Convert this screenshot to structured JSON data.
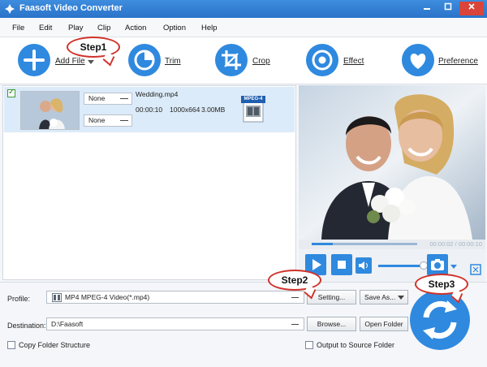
{
  "window": {
    "title": "Faasoft Video Converter"
  },
  "menu": [
    "File",
    "Edit",
    "Play",
    "Clip",
    "Action",
    "Option",
    "Help"
  ],
  "toolbar": {
    "add_file": "Add File",
    "trim": "Trim",
    "crop": "Crop",
    "effect": "Effect",
    "preference": "Preference"
  },
  "callouts": {
    "step1": "Step1",
    "step2": "Step2",
    "step3": "Step3"
  },
  "file": {
    "name": "Wedding.mp4",
    "duration": "00:00:10",
    "resolution": "1000x664",
    "size": "3.00MB",
    "subtitle": "None",
    "audio": "None",
    "format_badge": "MPEG-4",
    "checked": true
  },
  "player": {
    "time": "00:00:02 / 00:00:10",
    "progress": 0.2
  },
  "bottom": {
    "profile_label": "Profile:",
    "profile_value": "MP4 MPEG-4 Video(*.mp4)",
    "setting_button": "Setting...",
    "save_as_button": "Save As...",
    "destination_label": "Destination:",
    "destination_value": "D:\\Faasoft",
    "browse_button": "Browse...",
    "open_folder_button": "Open Folder",
    "copy_folder_label": "Copy Folder Structure",
    "output_source_label": "Output to Source Folder"
  },
  "colors": {
    "accent": "#2f89df",
    "callout_border": "#d0322a",
    "title_bar": "#2a73c9",
    "row_selected": "#dcebf9"
  }
}
